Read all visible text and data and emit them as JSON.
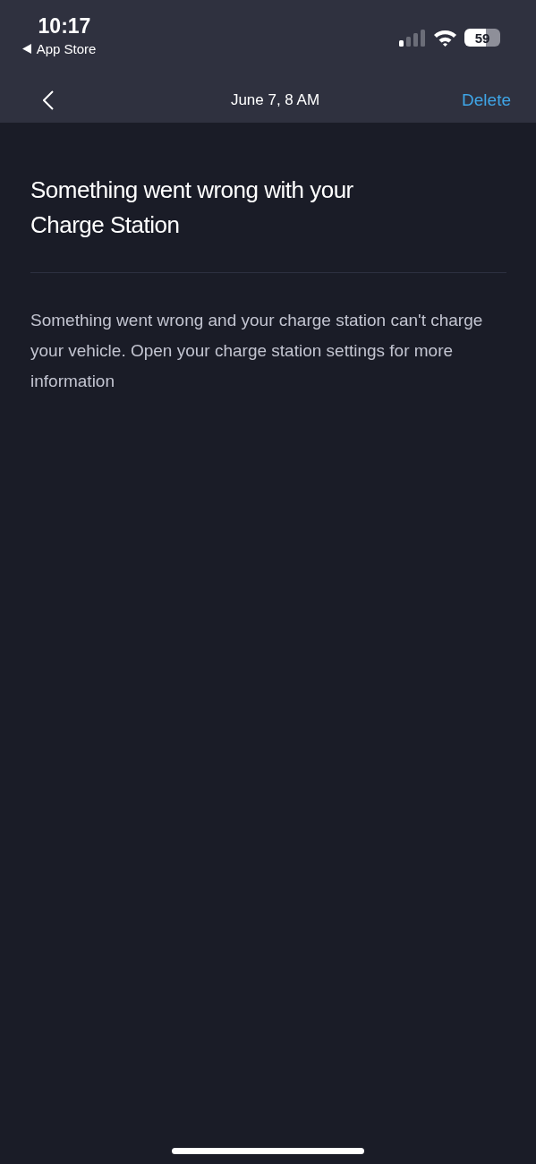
{
  "status_bar": {
    "time": "10:17",
    "back_app": "App Store",
    "battery": "59"
  },
  "nav": {
    "title": "June 7, 8 AM",
    "action": "Delete"
  },
  "message": {
    "title": "Something went wrong with your Charge Station",
    "body": "Something went wrong and your charge station can't charge your vehicle. Open your charge station settings for more information"
  }
}
